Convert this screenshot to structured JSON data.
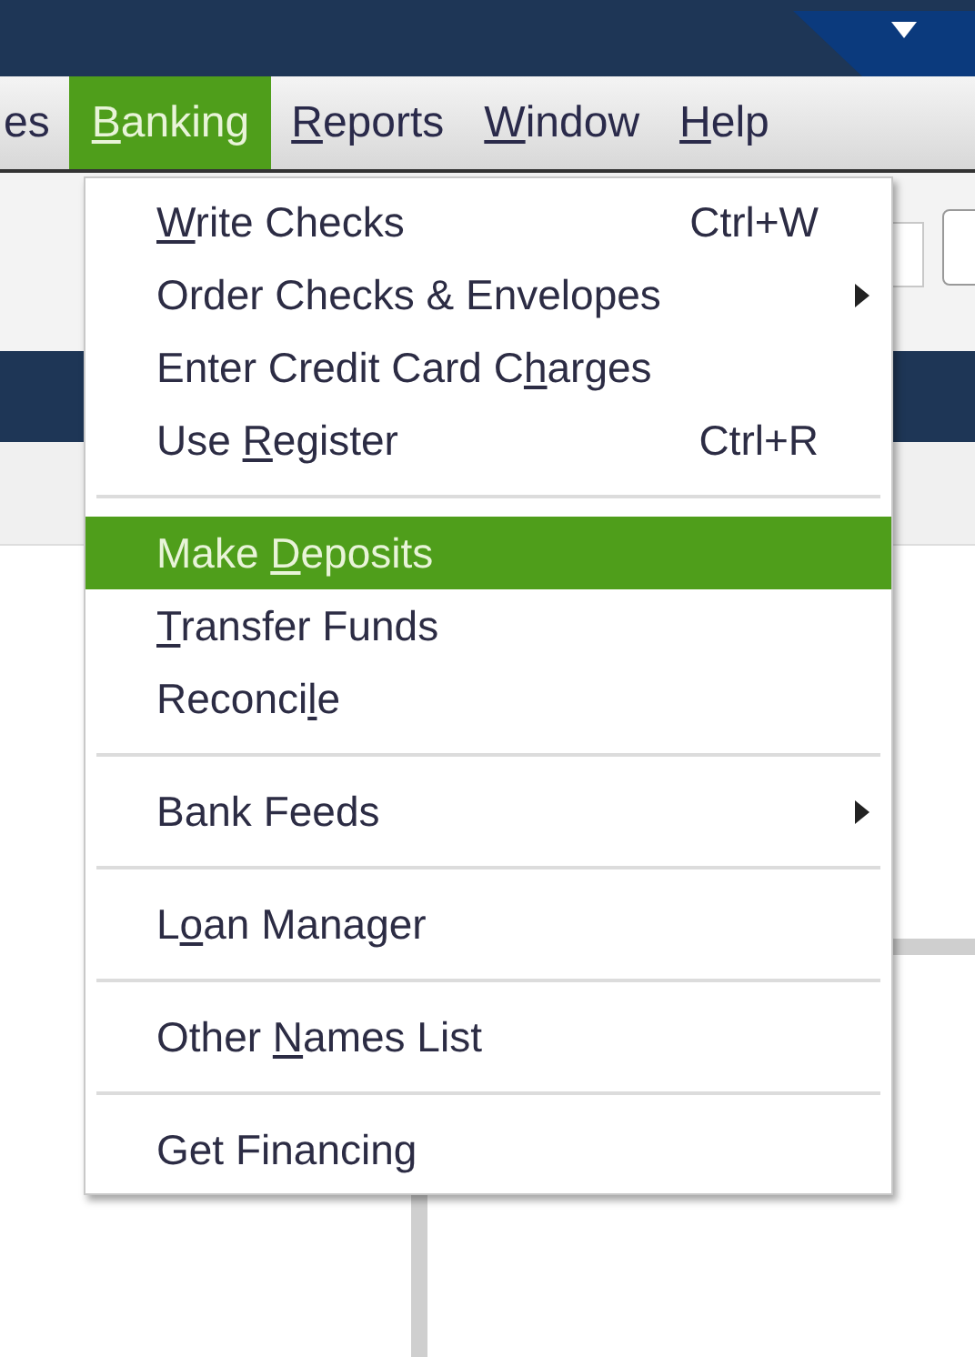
{
  "menu_bar": [
    {
      "post": "es",
      "selected": false
    },
    {
      "key": "B",
      "post": "anking",
      "selected": true
    },
    {
      "key": "R",
      "post": "eports",
      "selected": false
    },
    {
      "key": "W",
      "post": "indow",
      "selected": false
    },
    {
      "key": "H",
      "post": "elp",
      "selected": false
    }
  ],
  "banking_menu": [
    {
      "kind": "item",
      "key": "W",
      "post": "rite Checks",
      "shortcut": "Ctrl+W",
      "selected": false
    },
    {
      "kind": "item",
      "pre": "Order Checks & Envelopes",
      "submenu": true,
      "selected": false
    },
    {
      "kind": "item",
      "pre": "Enter Credit Card C",
      "key": "h",
      "post": "arges",
      "selected": false
    },
    {
      "kind": "item",
      "pre": "Use ",
      "key": "R",
      "post": "egister",
      "shortcut": "Ctrl+R",
      "selected": false
    },
    {
      "kind": "separator"
    },
    {
      "kind": "item",
      "pre": "Make ",
      "key": "D",
      "post": "eposits",
      "selected": true
    },
    {
      "kind": "item",
      "key": "T",
      "post": "ransfer Funds",
      "selected": false
    },
    {
      "kind": "item",
      "pre": "Reconci",
      "key": "l",
      "post": "e",
      "selected": false
    },
    {
      "kind": "separator"
    },
    {
      "kind": "item",
      "pre": "Bank Feeds",
      "submenu": true,
      "selected": false
    },
    {
      "kind": "separator"
    },
    {
      "kind": "item",
      "pre": "L",
      "key": "o",
      "post": "an Manager",
      "selected": false
    },
    {
      "kind": "separator"
    },
    {
      "kind": "item",
      "pre": "Other ",
      "key": "N",
      "post": "ames List",
      "selected": false
    },
    {
      "kind": "separator"
    },
    {
      "kind": "item",
      "pre": "Get Financing",
      "selected": false
    }
  ]
}
